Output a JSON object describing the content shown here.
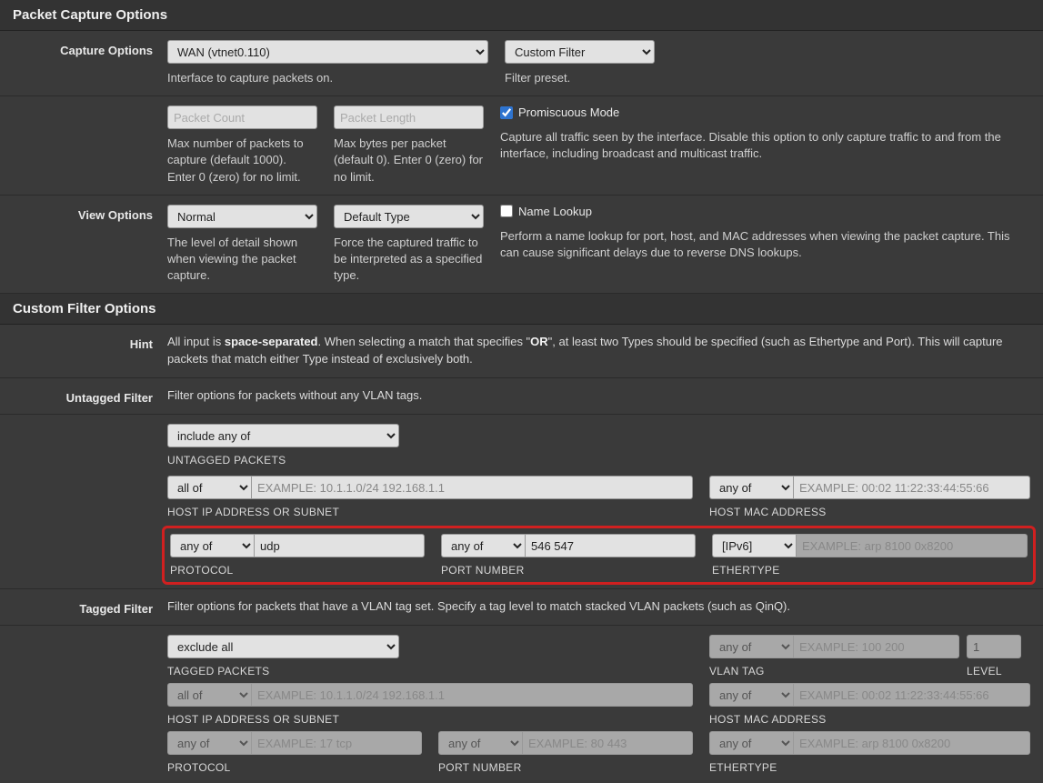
{
  "sections": {
    "pco_title": "Packet Capture Options",
    "cfo_title": "Custom Filter Options"
  },
  "capture": {
    "label": "Capture Options",
    "interface_value": "WAN (vtnet0.110)",
    "interface_help": "Interface to capture packets on.",
    "filter_preset_value": "Custom Filter",
    "filter_preset_help": "Filter preset.",
    "packet_count_placeholder": "Packet Count",
    "packet_count_help": "Max number of packets to capture (default 1000). Enter 0 (zero) for no limit.",
    "packet_length_placeholder": "Packet Length",
    "packet_length_help": "Max bytes per packet (default 0). Enter 0 (zero) for no limit.",
    "promiscuous_label": "Promiscuous Mode",
    "promiscuous_help": "Capture all traffic seen by the interface. Disable this option to only capture traffic to and from the interface, including broadcast and multicast traffic."
  },
  "view": {
    "label": "View Options",
    "detail_value": "Normal",
    "detail_help": "The level of detail shown when viewing the packet capture.",
    "type_value": "Default Type",
    "type_help": "Force the captured traffic to be interpreted as a specified type.",
    "name_lookup_label": "Name Lookup",
    "name_lookup_help": "Perform a name lookup for port, host, and MAC addresses when viewing the packet capture. This can cause significant delays due to reverse DNS lookups."
  },
  "hint": {
    "label": "Hint",
    "pre": "All input is ",
    "bold1": "space-separated",
    "mid": ". When selecting a match that specifies \"",
    "bold2": "OR",
    "post": "\", at least two Types should be specified (such as Ethertype and Port). This will capture packets that match either Type instead of exclusively both."
  },
  "untagged": {
    "label": "Untagged Filter",
    "desc": "Filter options for packets without any VLAN tags.",
    "packets_select": "include any of",
    "packets_sublabel": "UNTAGGED PACKETS",
    "host_select": "all of",
    "host_placeholder": "EXAMPLE: 10.1.1.0/24 192.168.1.1",
    "host_sublabel": "HOST IP ADDRESS OR SUBNET",
    "mac_select": "any of",
    "mac_placeholder": "EXAMPLE: 00:02 11:22:33:44:55:66",
    "mac_sublabel": "HOST MAC ADDRESS",
    "proto_select": "any of",
    "proto_value": "udp",
    "proto_sublabel": "PROTOCOL",
    "port_select": "any of",
    "port_value": "546 547",
    "port_sublabel": "PORT NUMBER",
    "eth_select": "[IPv6]",
    "eth_placeholder": "EXAMPLE: arp 8100 0x8200",
    "eth_sublabel": "ETHERTYPE"
  },
  "tagged": {
    "label": "Tagged Filter",
    "desc": "Filter options for packets that have a VLAN tag set. Specify a tag level to match stacked VLAN packets (such as QinQ).",
    "packets_select": "exclude all",
    "packets_sublabel": "TAGGED PACKETS",
    "vlan_select": "any of",
    "vlan_placeholder": "EXAMPLE: 100 200",
    "vlan_sublabel": "VLAN TAG",
    "level_value": "1",
    "level_sublabel": "LEVEL",
    "host_select": "all of",
    "host_placeholder": "EXAMPLE: 10.1.1.0/24 192.168.1.1",
    "host_sublabel": "HOST IP ADDRESS OR SUBNET",
    "mac_select": "any of",
    "mac_placeholder": "EXAMPLE: 00:02 11:22:33:44:55:66",
    "mac_sublabel": "HOST MAC ADDRESS",
    "proto_select": "any of",
    "proto_placeholder": "EXAMPLE: 17 tcp",
    "proto_sublabel": "PROTOCOL",
    "port_select": "any of",
    "port_placeholder": "EXAMPLE: 80 443",
    "port_sublabel": "PORT NUMBER",
    "eth_select": "any of",
    "eth_placeholder": "EXAMPLE: arp 8100 0x8200",
    "eth_sublabel": "ETHERTYPE"
  }
}
